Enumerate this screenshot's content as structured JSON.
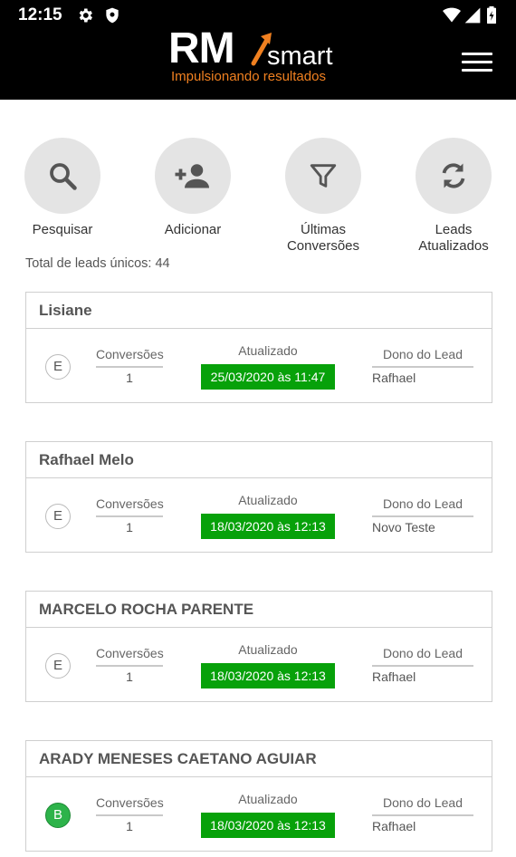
{
  "status_bar": {
    "time": "12:15"
  },
  "logo": {
    "rm": "RM",
    "smart": "smart",
    "tagline": "Impulsionando resultados"
  },
  "actions": [
    {
      "label": "Pesquisar",
      "icon": "search-icon"
    },
    {
      "label": "Adicionar",
      "icon": "add-person-icon"
    },
    {
      "label": "Últimas\nConversões",
      "icon": "filter-icon"
    },
    {
      "label": "Leads\nAtualizados",
      "icon": "refresh-icon"
    }
  ],
  "total_text": "Total de leads únicos: 44",
  "column_labels": {
    "conversions": "Conversões",
    "updated": "Atualizado",
    "owner": "Dono do Lead"
  },
  "leads": [
    {
      "name": "Lisiane",
      "badge": "E",
      "badge_color": "#ffffff",
      "conversions": "1",
      "updated": "25/03/2020 às 11:47",
      "owner": "Rafhael"
    },
    {
      "name": "Rafhael Melo",
      "badge": "E",
      "badge_color": "#ffffff",
      "conversions": "1",
      "updated": "18/03/2020 às 12:13",
      "owner": "Novo Teste"
    },
    {
      "name": "MARCELO ROCHA PARENTE",
      "badge": "E",
      "badge_color": "#ffffff",
      "conversions": "1",
      "updated": "18/03/2020 às 12:13",
      "owner": "Rafhael"
    },
    {
      "name": "ARADY MENESES CAETANO AGUIAR",
      "badge": "B",
      "badge_color": "#2db34a",
      "conversions": "1",
      "updated": "18/03/2020 às 12:13",
      "owner": "Rafhael"
    }
  ],
  "colors": {
    "topbar": "#000000",
    "accent_orange": "#f08020",
    "updated_green": "#07a10a",
    "badge_b_green": "#2db34a"
  }
}
